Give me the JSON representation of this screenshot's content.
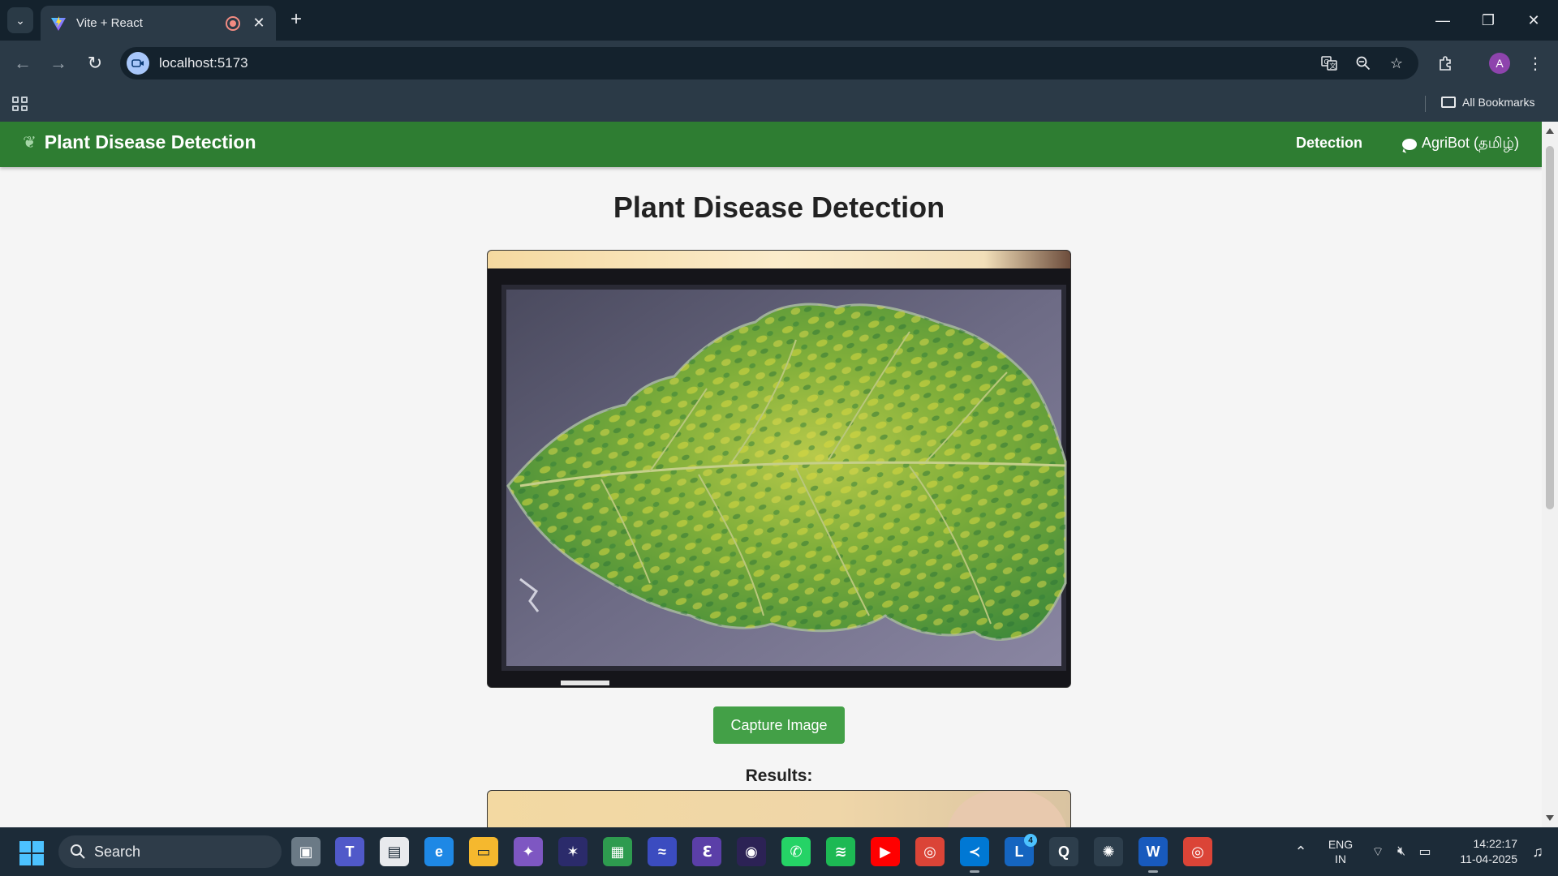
{
  "browser": {
    "tab_title": "Vite + React",
    "url": "localhost:5173",
    "all_bookmarks": "All Bookmarks",
    "profile_initial": "A"
  },
  "app": {
    "brand": "Plant Disease Detection",
    "nav": {
      "detection": "Detection",
      "agribot": "AgriBot (தமிழ்)"
    },
    "title": "Plant Disease Detection",
    "capture_button": "Capture Image",
    "results_label": "Results:"
  },
  "taskbar": {
    "search_label": "Search",
    "lang_line1": "ENG",
    "lang_line2": "IN",
    "time": "14:22:17",
    "date": "11-04-2025",
    "notification_count": "4"
  }
}
